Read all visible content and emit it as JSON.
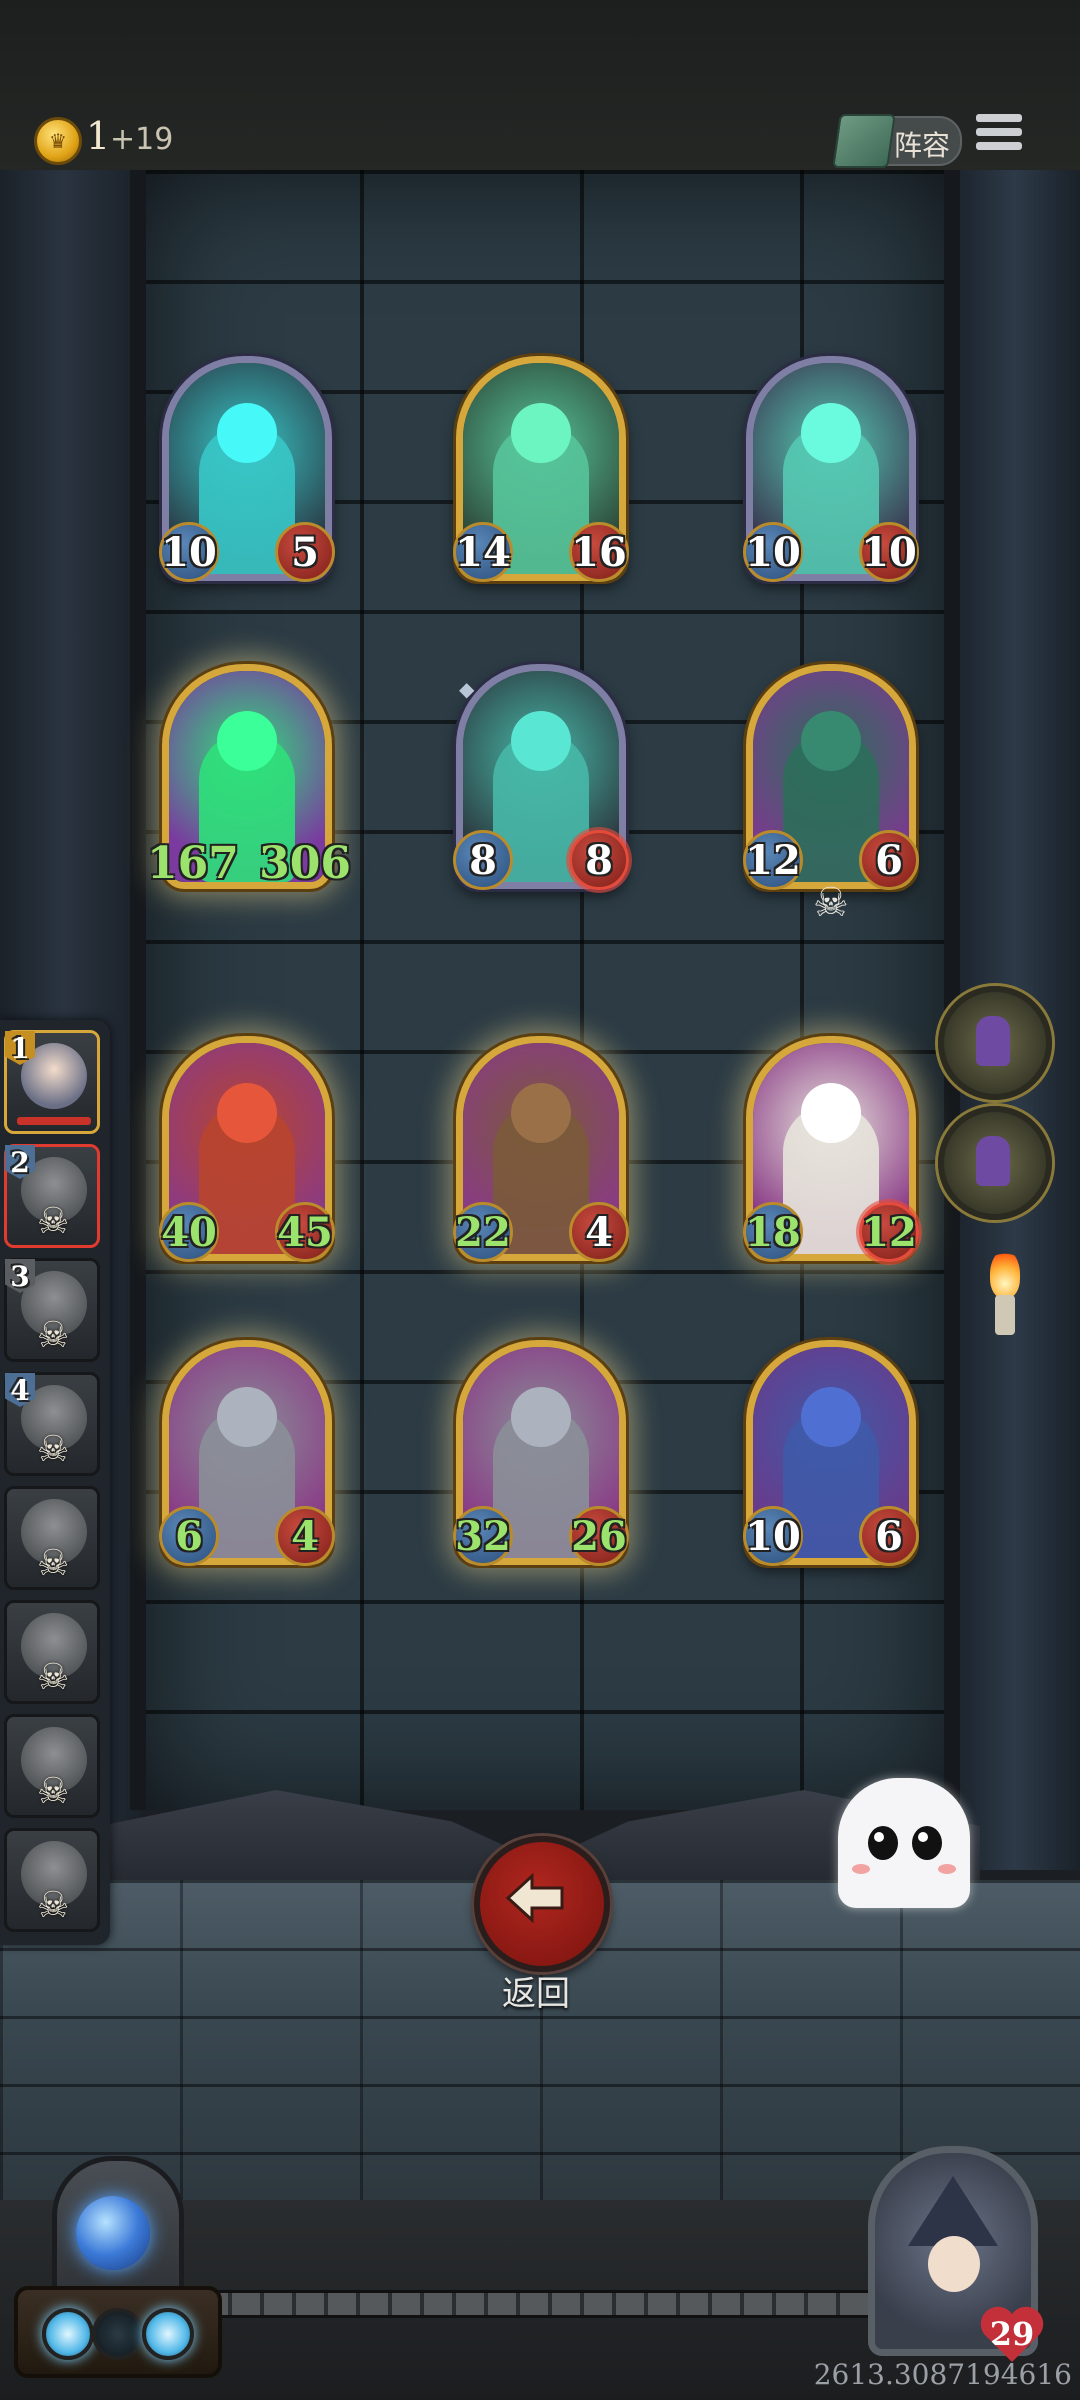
{
  "topbar": {
    "coins": "1",
    "coin_income": "+19",
    "lineup_label": "阵容"
  },
  "board": {
    "rows": [
      [
        {
          "name": "spectral-wolf",
          "atk": "10",
          "hp": "5",
          "frame": "silver",
          "tint": "#38c6c6",
          "bg": "#2a3f4a"
        },
        {
          "name": "spectral-bearded-soldier",
          "atk": "14",
          "hp": "16",
          "frame": "gold",
          "tint": "#56c49a",
          "bg": "#2e4a3a"
        },
        {
          "name": "spectral-demon-with-red-cloak",
          "atk": "10",
          "hp": "10",
          "frame": "silver",
          "tint": "#55c9b2",
          "bg": "#3a3a52"
        }
      ],
      [
        {
          "name": "green-ghost-rogue",
          "atk": "167",
          "hp": "306",
          "frame": "gold",
          "tint": "#2fe07a",
          "bg": "#7a3aa0",
          "buffed": true
        },
        {
          "name": "spectral-skeleton",
          "atk": "8",
          "hp": "8",
          "frame": "silver",
          "tint": "#47b8a8",
          "bg": "#2c3a40",
          "hp_star": true
        },
        {
          "name": "sorceress-with-skull",
          "atk": "12",
          "hp": "6",
          "frame": "gold",
          "tint": "#2c6e5a",
          "bg": "#7b3a8f",
          "skull": true
        }
      ],
      [
        {
          "name": "armored-squire",
          "atk": "40",
          "hp": "45",
          "frame": "gold",
          "tint": "#b8452e",
          "bg": "#8a3a86",
          "buffed": true
        },
        {
          "name": "young-blacksmith",
          "atk": "22",
          "hp": "4",
          "frame": "gold",
          "tint": "#7b5a3a",
          "bg": "#8a3a86",
          "atk_buffed": true
        },
        {
          "name": "hooded-old-sage",
          "atk": "18",
          "hp": "12",
          "frame": "gold",
          "tint": "#e7e4dc",
          "bg": "#8a3a86",
          "buffed": true,
          "hp_star": true
        }
      ],
      [
        {
          "name": "helmeted-guard",
          "atk": "6",
          "hp": "4",
          "frame": "gold",
          "tint": "#8a8f98",
          "bg": "#8a3a86",
          "buffed": true
        },
        {
          "name": "helmeted-guard",
          "atk": "32",
          "hp": "26",
          "frame": "gold",
          "tint": "#8a8f98",
          "bg": "#8a3a86",
          "buffed": true
        },
        {
          "name": "blue-gold-knight",
          "atk": "10",
          "hp": "6",
          "frame": "gold",
          "tint": "#3f5aa8",
          "bg": "#6a3a8a"
        }
      ]
    ]
  },
  "lineup": [
    {
      "number": "1",
      "state": "active",
      "badge": "gold"
    },
    {
      "number": "2",
      "state": "selected",
      "badge": "blue",
      "skull": true
    },
    {
      "number": "3",
      "state": "defeated",
      "badge": "grey",
      "skull": true
    },
    {
      "number": "4",
      "state": "defeated",
      "badge": "blue",
      "skull": true
    },
    {
      "number": "",
      "state": "defeated",
      "skull": true
    },
    {
      "number": "",
      "state": "defeated",
      "skull": true
    },
    {
      "number": "",
      "state": "defeated",
      "skull": true
    },
    {
      "number": "",
      "state": "defeated",
      "skull": true
    }
  ],
  "back_button": {
    "label": "返回"
  },
  "hero": {
    "hp": "29"
  },
  "footer": {
    "seed": "2613.3087194616"
  },
  "colors": {
    "gold_frame": "#d6a73a",
    "silver_frame": "#7f7fa5",
    "buff_green": "#9be36c",
    "back_red": "#b0271f"
  },
  "icons": [
    "coin-icon",
    "lineup-book-icon",
    "menu-icon",
    "back-arrow-icon",
    "skull-icon",
    "ghost-mascot",
    "crystal-orb-icon",
    "heart-icon"
  ]
}
